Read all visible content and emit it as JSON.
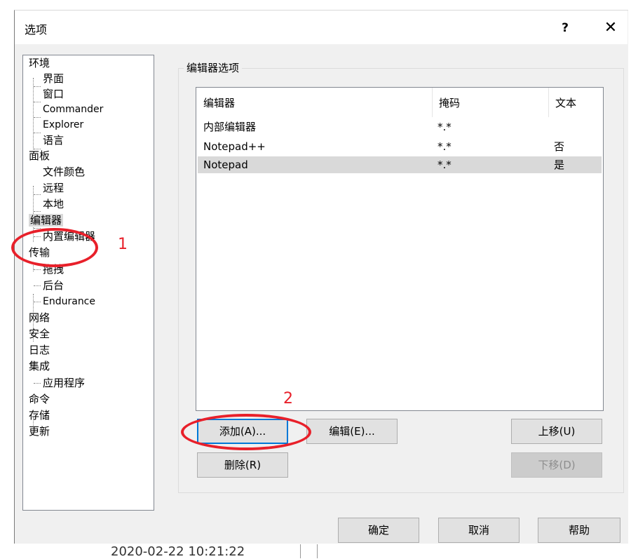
{
  "window": {
    "title": "选项",
    "help_glyph": "?",
    "close_glyph": "✕"
  },
  "tree": {
    "nodes": [
      {
        "label": "环境",
        "level": 0
      },
      {
        "label": "界面",
        "level": 1
      },
      {
        "label": "窗口",
        "level": 1
      },
      {
        "label": "Commander",
        "level": 1
      },
      {
        "label": "Explorer",
        "level": 1
      },
      {
        "label": "语言",
        "level": 1
      },
      {
        "label": "面板",
        "level": 0
      },
      {
        "label": "文件颜色",
        "level": 1
      },
      {
        "label": "远程",
        "level": 1
      },
      {
        "label": "本地",
        "level": 1
      },
      {
        "label": "编辑器",
        "level": 0,
        "selected": true
      },
      {
        "label": "内置编辑器",
        "level": 1
      },
      {
        "label": "传输",
        "level": 0
      },
      {
        "label": "拖拽",
        "level": 1
      },
      {
        "label": "后台",
        "level": 1
      },
      {
        "label": "Endurance",
        "level": 1
      },
      {
        "label": "网络",
        "level": 0
      },
      {
        "label": "安全",
        "level": 0
      },
      {
        "label": "日志",
        "level": 0
      },
      {
        "label": "集成",
        "level": 0
      },
      {
        "label": "应用程序",
        "level": 1
      },
      {
        "label": "命令",
        "level": 0
      },
      {
        "label": "存储",
        "level": 0
      },
      {
        "label": "更新",
        "level": 0
      }
    ]
  },
  "editor_options": {
    "group_title": "编辑器选项",
    "columns": [
      "编辑器",
      "掩码",
      "文本"
    ],
    "rows": [
      {
        "editor": "内部编辑器",
        "mask": "*.*",
        "text": ""
      },
      {
        "editor": "Notepad++",
        "mask": "*.*",
        "text": "否"
      },
      {
        "editor": "Notepad",
        "mask": "*.*",
        "text": "是",
        "selected": true
      }
    ],
    "buttons": {
      "add": "添加(A)...",
      "edit": "编辑(E)...",
      "move_up": "上移(U)",
      "remove": "删除(R)",
      "move_down": "下移(D)"
    }
  },
  "footer": {
    "ok": "确定",
    "cancel": "取消",
    "help": "帮助"
  },
  "annotations": {
    "marker_1": "1",
    "marker_2": "2",
    "color": "#e8202a"
  },
  "background_window": {
    "timestamp": "2020-02-22  10:21:22"
  }
}
